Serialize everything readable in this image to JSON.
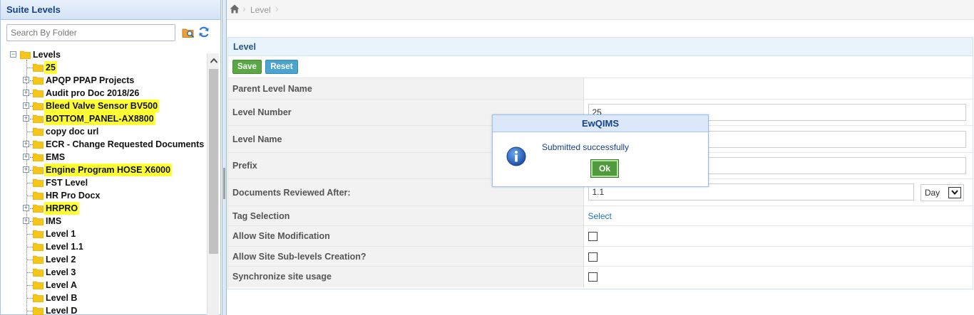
{
  "left_panel": {
    "title": "Suite Levels",
    "search_placeholder": "Search By Folder",
    "tree": {
      "root": "Levels",
      "items": [
        {
          "label": "25",
          "highlight": true,
          "expandable": false
        },
        {
          "label": "APQP PPAP Projects",
          "highlight": false,
          "expandable": true
        },
        {
          "label": "Audit pro Doc 2018/26",
          "highlight": false,
          "expandable": true
        },
        {
          "label": "Bleed Valve Sensor BV500",
          "highlight": true,
          "expandable": true
        },
        {
          "label": "BOTTOM_PANEL-AX8800",
          "highlight": true,
          "expandable": true
        },
        {
          "label": "copy doc url",
          "highlight": false,
          "expandable": false
        },
        {
          "label": "ECR - Change Requested Documents",
          "highlight": false,
          "expandable": true
        },
        {
          "label": "EMS",
          "highlight": false,
          "expandable": true
        },
        {
          "label": "Engine Program HOSE X6000",
          "highlight": true,
          "expandable": true
        },
        {
          "label": "FST Level",
          "highlight": false,
          "expandable": false
        },
        {
          "label": "HR Pro Docx",
          "highlight": false,
          "expandable": false
        },
        {
          "label": "HRPRO",
          "highlight": true,
          "expandable": true
        },
        {
          "label": "IMS",
          "highlight": false,
          "expandable": true
        },
        {
          "label": "Level 1",
          "highlight": false,
          "expandable": false
        },
        {
          "label": "Level 1.1",
          "highlight": false,
          "expandable": false
        },
        {
          "label": "Level 2",
          "highlight": false,
          "expandable": false
        },
        {
          "label": "Level 3",
          "highlight": false,
          "expandable": false
        },
        {
          "label": "Level A",
          "highlight": false,
          "expandable": false
        },
        {
          "label": "Level B",
          "highlight": false,
          "expandable": false
        },
        {
          "label": "Level D",
          "highlight": false,
          "expandable": false
        }
      ]
    }
  },
  "breadcrumb": {
    "items": [
      "Level"
    ]
  },
  "form": {
    "title": "Level",
    "buttons": {
      "save": "Save",
      "reset": "Reset"
    },
    "fields": {
      "parent_level_name": {
        "label": "Parent Level Name",
        "value": ""
      },
      "level_number": {
        "label": "Level Number",
        "value": "25"
      },
      "level_name": {
        "label": "Level Name",
        "value": ""
      },
      "prefix": {
        "label": "Prefix",
        "value": ""
      },
      "documents_reviewed_after": {
        "label": "Documents Reviewed After:",
        "value": "1.1",
        "unit": "Day"
      },
      "tag_selection": {
        "label": "Tag Selection",
        "link": "Select"
      },
      "allow_site_modification": {
        "label": "Allow Site Modification",
        "checked": false
      },
      "allow_sublevels": {
        "label": "Allow Site Sub-levels Creation?",
        "checked": false
      },
      "synchronize_site_usage": {
        "label": "Synchronize site usage",
        "checked": false
      }
    }
  },
  "dialog": {
    "title": "EwQIMS",
    "message": "Submitted successfully",
    "ok_label": "Ok"
  },
  "colors": {
    "highlight": "#ffff33",
    "folder": "#f5c518",
    "save": "#5aa845",
    "reset": "#4ba3cf",
    "link": "#1a75bb"
  }
}
